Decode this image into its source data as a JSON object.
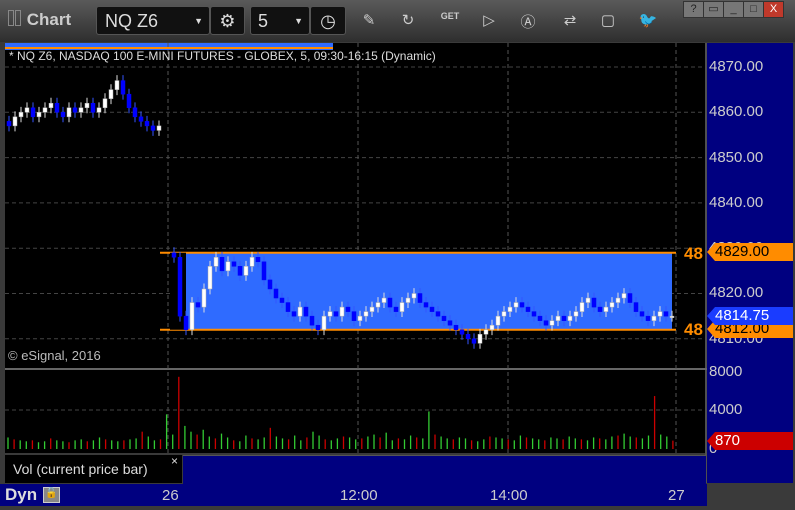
{
  "app": {
    "title": "Chart",
    "symbol": "NQ Z6",
    "interval": "5",
    "window_buttons": [
      "?",
      "▭",
      "_",
      "□",
      "X"
    ]
  },
  "toolbar_icons": [
    "gear-icon",
    "clock-icon",
    "pencil-icon",
    "chart-refresh-icon",
    "get-icon",
    "play-icon",
    "alert-icon",
    "link-icon",
    "comment-icon",
    "twitter-icon"
  ],
  "legend": "* NQ Z6, NASDAQ 100 E-MINI FUTURES - GLOBEX, 5, 09:30-16:15 (Dynamic)",
  "copyright": "© eSignal, 2016",
  "price_axis": [
    "4870.00",
    "4860.00",
    "4850.00",
    "4840.00",
    "4830.00",
    "4820.00",
    "4810.00"
  ],
  "volume_axis": [
    "8000",
    "4000",
    "0"
  ],
  "tags": {
    "upper": "4829.00",
    "current": "4814.75",
    "lower": "4812.00",
    "volume": "870",
    "upper_short": "48",
    "lower_short": "48"
  },
  "time_axis": [
    "26",
    "12:00",
    "14:00",
    "27"
  ],
  "vol_label": "Vol (current price bar)",
  "vol_close": "×",
  "dyn_label": "Dyn",
  "colors": {
    "up": "#ffffff",
    "down": "#0000ff",
    "range": "#2f6bff",
    "orange": "#ff8c00",
    "vol_up": "#33cc33",
    "vol_down": "#cc0000"
  },
  "chart_data": {
    "type": "candlestick",
    "range_box": [
      4812,
      4829
    ],
    "day1_closes": [
      4857,
      4859,
      4860,
      4861,
      4859,
      4860,
      4861,
      4862,
      4860,
      4859,
      4861,
      4860,
      4861,
      4862,
      4860,
      4861,
      4863,
      4865,
      4867,
      4864,
      4861,
      4859,
      4858,
      4857,
      4856,
      4857
    ],
    "day2_closes": [
      4828,
      4815,
      4812,
      4818,
      4817,
      4821,
      4826,
      4828,
      4825,
      4827,
      4826,
      4824,
      4826,
      4828,
      4827,
      4823,
      4821,
      4819,
      4818,
      4816,
      4815,
      4817,
      4815,
      4813,
      4812,
      4815,
      4816,
      4815,
      4817,
      4816,
      4814,
      4815,
      4816,
      4817,
      4818,
      4819,
      4817,
      4816,
      4818,
      4819,
      4820,
      4818,
      4817,
      4816,
      4815,
      4814,
      4813,
      4812,
      4811,
      4810,
      4809,
      4811,
      4812,
      4813,
      4815,
      4816,
      4817,
      4818,
      4817,
      4816,
      4815,
      4814,
      4813,
      4814,
      4815,
      4814,
      4815,
      4816,
      4818,
      4819,
      4817,
      4816,
      4817,
      4818,
      4819,
      4820,
      4818,
      4816,
      4815,
      4814,
      4815,
      4816,
      4815,
      4815
    ],
    "volumes": [
      1200,
      1000,
      900,
      800,
      900,
      700,
      800,
      1100,
      900,
      800,
      700,
      900,
      1000,
      800,
      900,
      1200,
      1000,
      900,
      800,
      900,
      1000,
      1100,
      1800,
      1300,
      900,
      1000,
      3600,
      1500,
      7500,
      2400,
      1800,
      1500,
      2000,
      1300,
      1100,
      1600,
      1200,
      900,
      800,
      1400,
      1100,
      1000,
      1200,
      2200,
      1300,
      1100,
      1000,
      1400,
      900,
      1200,
      1800,
      1400,
      1000,
      900,
      1100,
      1300,
      1200,
      1000,
      1100,
      1300,
      1500,
      1200,
      1700,
      900,
      1100,
      1000,
      1400,
      1200,
      1100,
      3900,
      1500,
      1300,
      1100,
      1000,
      1200,
      1100,
      900,
      800,
      1000,
      1300,
      1200,
      1100,
      1000,
      900,
      1400,
      1200,
      1100,
      1000,
      900,
      1200,
      1100,
      1000,
      1300,
      1100,
      1000,
      900,
      1200,
      1100,
      1000,
      1300,
      1400,
      1600,
      1300,
      1200,
      1100,
      1400,
      5500,
      1500,
      1300,
      870
    ]
  }
}
